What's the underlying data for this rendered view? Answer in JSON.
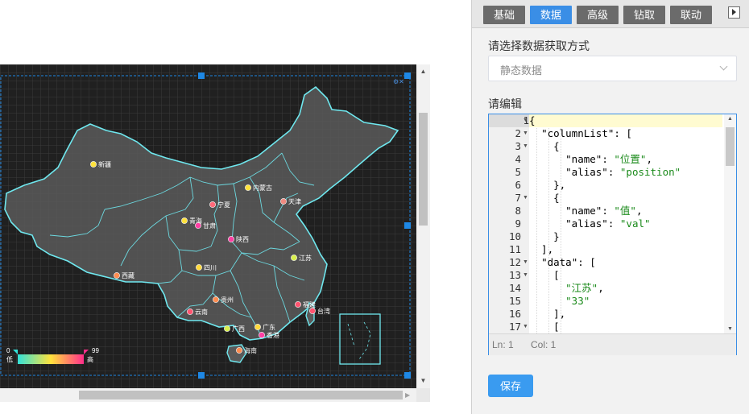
{
  "map": {
    "legend": {
      "min_value": "0",
      "max_value": "99",
      "low_label": "低",
      "high_label": "高",
      "gradient": [
        "#33e1d8",
        "#ffe23c",
        "#ff2e8a"
      ]
    },
    "provinces": [
      {
        "name": "新疆",
        "color": "#ffe23c"
      },
      {
        "name": "内蒙古",
        "color": "#ffe23c"
      },
      {
        "name": "天津",
        "color": "#f08a80"
      },
      {
        "name": "宁夏",
        "color": "#ff6a7a"
      },
      {
        "name": "青海",
        "color": "#ffe23c"
      },
      {
        "name": "甘肃",
        "color": "#ff3fa4"
      },
      {
        "name": "陕西",
        "color": "#ff3fa4"
      },
      {
        "name": "四川",
        "color": "#ffd93c"
      },
      {
        "name": "江苏",
        "color": "#d8f04c"
      },
      {
        "name": "西藏",
        "color": "#ff8c50"
      },
      {
        "name": "贵州",
        "color": "#ff8c50"
      },
      {
        "name": "云南",
        "color": "#ff5470"
      },
      {
        "name": "福建",
        "color": "#ff5470"
      },
      {
        "name": "台湾",
        "color": "#ff5470"
      },
      {
        "name": "广西",
        "color": "#d8f04c"
      },
      {
        "name": "广东",
        "color": "#ffd93c"
      },
      {
        "name": "香港",
        "color": "#ff3fa4"
      },
      {
        "name": "海南",
        "color": "#ff8c50"
      }
    ],
    "colors": {
      "background": "#202020",
      "outline": "#6fe8ef",
      "land": "#5a5a5a",
      "selection": "#1e88e5"
    }
  },
  "panel": {
    "tabs": [
      {
        "label": "基础",
        "active": false
      },
      {
        "label": "数据",
        "active": true
      },
      {
        "label": "高级",
        "active": false
      },
      {
        "label": "钻取",
        "active": false
      },
      {
        "label": "联动",
        "active": false
      }
    ],
    "data_source_label": "请选择数据获取方式",
    "data_source_value": "静态数据",
    "editor_label": "请编辑",
    "editor": {
      "lines": [
        {
          "n": "1",
          "fold": true,
          "text": "{"
        },
        {
          "n": "2",
          "fold": true,
          "text": "  \"columnList\": ["
        },
        {
          "n": "3",
          "fold": true,
          "text": "    {"
        },
        {
          "n": "4",
          "fold": false,
          "text": "      \"name\": \"位置\","
        },
        {
          "n": "5",
          "fold": false,
          "text": "      \"alias\": \"position\""
        },
        {
          "n": "6",
          "fold": false,
          "text": "    },"
        },
        {
          "n": "7",
          "fold": true,
          "text": "    {"
        },
        {
          "n": "8",
          "fold": false,
          "text": "      \"name\": \"值\","
        },
        {
          "n": "9",
          "fold": false,
          "text": "      \"alias\": \"val\""
        },
        {
          "n": "10",
          "fold": false,
          "text": "    }"
        },
        {
          "n": "11",
          "fold": false,
          "text": "  ],"
        },
        {
          "n": "12",
          "fold": true,
          "text": "  \"data\": ["
        },
        {
          "n": "13",
          "fold": true,
          "text": "    ["
        },
        {
          "n": "14",
          "fold": false,
          "text": "      \"江苏\","
        },
        {
          "n": "15",
          "fold": false,
          "text": "      \"33\""
        },
        {
          "n": "16",
          "fold": false,
          "text": "    ],"
        },
        {
          "n": "17",
          "fold": true,
          "text": "    ["
        }
      ],
      "status_line": "Ln: 1",
      "status_col": "Col: 1"
    },
    "save_label": "保存"
  }
}
